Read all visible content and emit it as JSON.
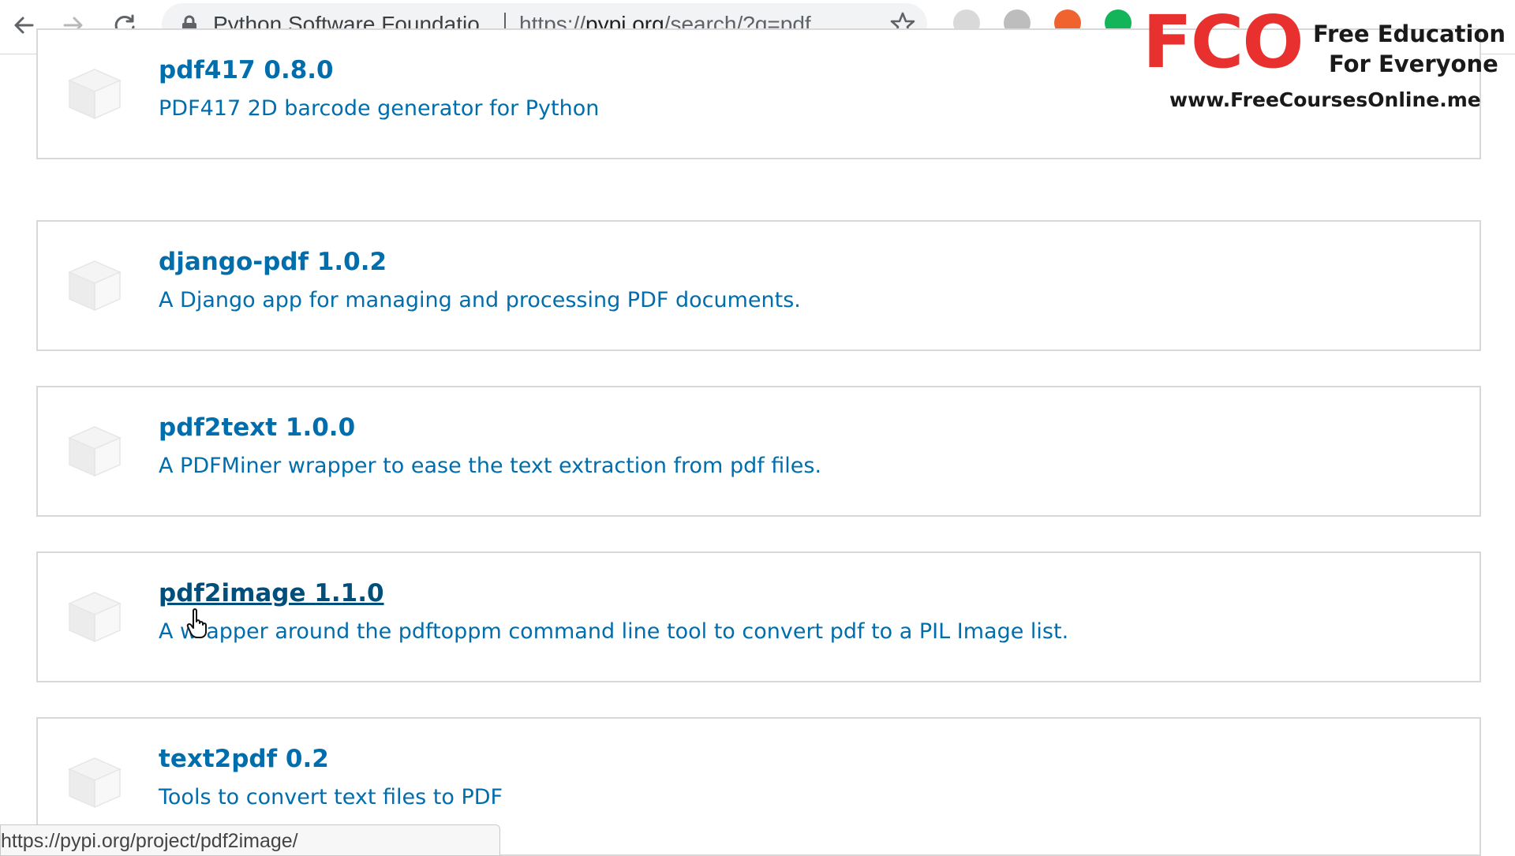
{
  "browser": {
    "site_name": "Python Software Foundatio",
    "url_scheme": "https://",
    "url_host": "pypi.org",
    "url_path": "/search/?q=pdf",
    "status_url": "https://pypi.org/project/pdf2image/",
    "icons": {
      "back": "arrow-left-icon",
      "forward": "arrow-right-icon",
      "reload": "reload-icon",
      "lock": "lock-icon",
      "bookmark": "star-icon"
    },
    "extensions": [
      {
        "name": "extension-icon-1",
        "color": "#d9d9d9"
      },
      {
        "name": "extension-icon-2",
        "color": "#bdbdbd"
      },
      {
        "name": "extension-icon-3",
        "color": "#f0632e"
      },
      {
        "name": "grammarly-icon",
        "color": "#14b45a"
      }
    ]
  },
  "watermark": {
    "logo": "FCO",
    "line1": "Free Education",
    "line2": "For Everyone",
    "line3": "www.FreeCoursesOnline.me",
    "logo_color": "#e8312f"
  },
  "packages": [
    {
      "title": "pdf417 0.8.0",
      "description": "PDF417 2D barcode generator for Python"
    },
    {
      "title": "django-pdf 1.0.2",
      "description": "A Django app for managing and processing PDF documents."
    },
    {
      "title": "pdf2text 1.0.0",
      "description": "A PDFMiner wrapper to ease the text extraction from pdf files."
    },
    {
      "title": "pdf2image 1.1.0",
      "description": "A wrapper around the pdftoppm command line tool to convert pdf to a PIL Image list.",
      "hovered": true
    },
    {
      "title": "text2pdf 0.2",
      "description": "Tools to convert text files to PDF"
    }
  ],
  "colors": {
    "link": "#006dad",
    "link_hover": "#004e7c",
    "card_border": "#d8d8d8"
  }
}
